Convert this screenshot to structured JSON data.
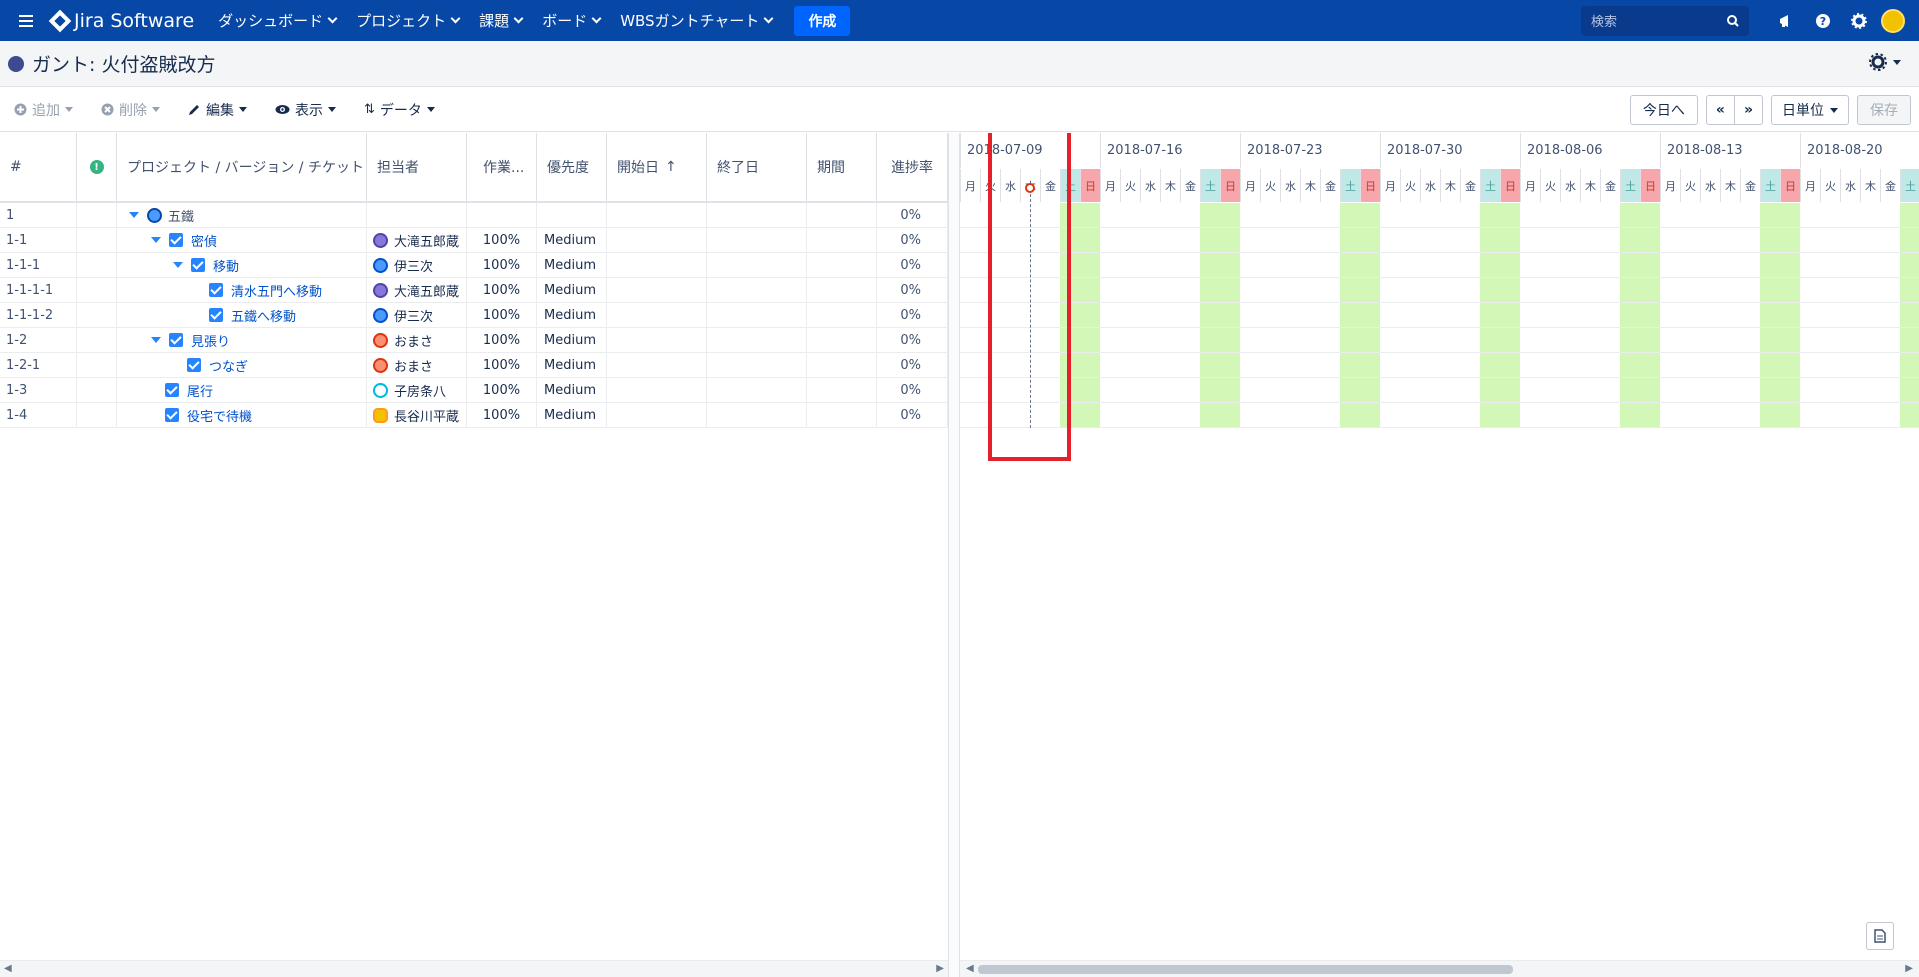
{
  "nav": {
    "brand": "Jira Software",
    "items": [
      "ダッシュボード",
      "プロジェクト",
      "課題",
      "ボード",
      "WBSガントチャート"
    ],
    "create_label": "作成",
    "search_placeholder": "検索"
  },
  "header": {
    "title": "ガント: 火付盗賊改方"
  },
  "toolbar": {
    "add": "追加",
    "delete": "削除",
    "edit": "編集",
    "view": "表示",
    "data": "データ",
    "today": "今日へ",
    "prev": "«",
    "next": "»",
    "unit": "日単位",
    "save": "保存"
  },
  "columns": {
    "num": "#",
    "name": "プロジェクト / バージョン / チケット",
    "assignee": "担当者",
    "work": "作業...",
    "priority": "優先度",
    "start": "開始日",
    "end": "終了日",
    "duration": "期間",
    "progress": "進捗率"
  },
  "rows": [
    {
      "num": "1",
      "name": "五鐵",
      "assignee": "",
      "work": "",
      "priority": "",
      "progress": "0%"
    },
    {
      "num": "1-1",
      "name": "密偵",
      "assignee": "大滝五郎蔵",
      "work": "100%",
      "priority": "Medium",
      "progress": "0%"
    },
    {
      "num": "1-1-1",
      "name": "移動",
      "assignee": "伊三次",
      "work": "100%",
      "priority": "Medium",
      "progress": "0%"
    },
    {
      "num": "1-1-1-1",
      "name": "清水五門へ移動",
      "assignee": "大滝五郎蔵",
      "work": "100%",
      "priority": "Medium",
      "progress": "0%"
    },
    {
      "num": "1-1-1-2",
      "name": "五鐵へ移動",
      "assignee": "伊三次",
      "work": "100%",
      "priority": "Medium",
      "progress": "0%"
    },
    {
      "num": "1-2",
      "name": "見張り",
      "assignee": "おまさ",
      "work": "100%",
      "priority": "Medium",
      "progress": "0%"
    },
    {
      "num": "1-2-1",
      "name": "つなぎ",
      "assignee": "おまさ",
      "work": "100%",
      "priority": "Medium",
      "progress": "0%"
    },
    {
      "num": "1-3",
      "name": "尾行",
      "assignee": "子房条八",
      "work": "100%",
      "priority": "Medium",
      "progress": "0%"
    },
    {
      "num": "1-4",
      "name": "役宅で待機",
      "assignee": "長谷川平蔵",
      "work": "100%",
      "priority": "Medium",
      "progress": "0%"
    }
  ],
  "gantt": {
    "weeks": [
      "2018-07-09",
      "2018-07-16",
      "2018-07-23",
      "2018-07-30",
      "2018-08-06",
      "2018-08-13",
      "2018-08-20"
    ],
    "day_labels": [
      "月",
      "火",
      "水",
      "木",
      "金",
      "土",
      "日"
    ]
  }
}
